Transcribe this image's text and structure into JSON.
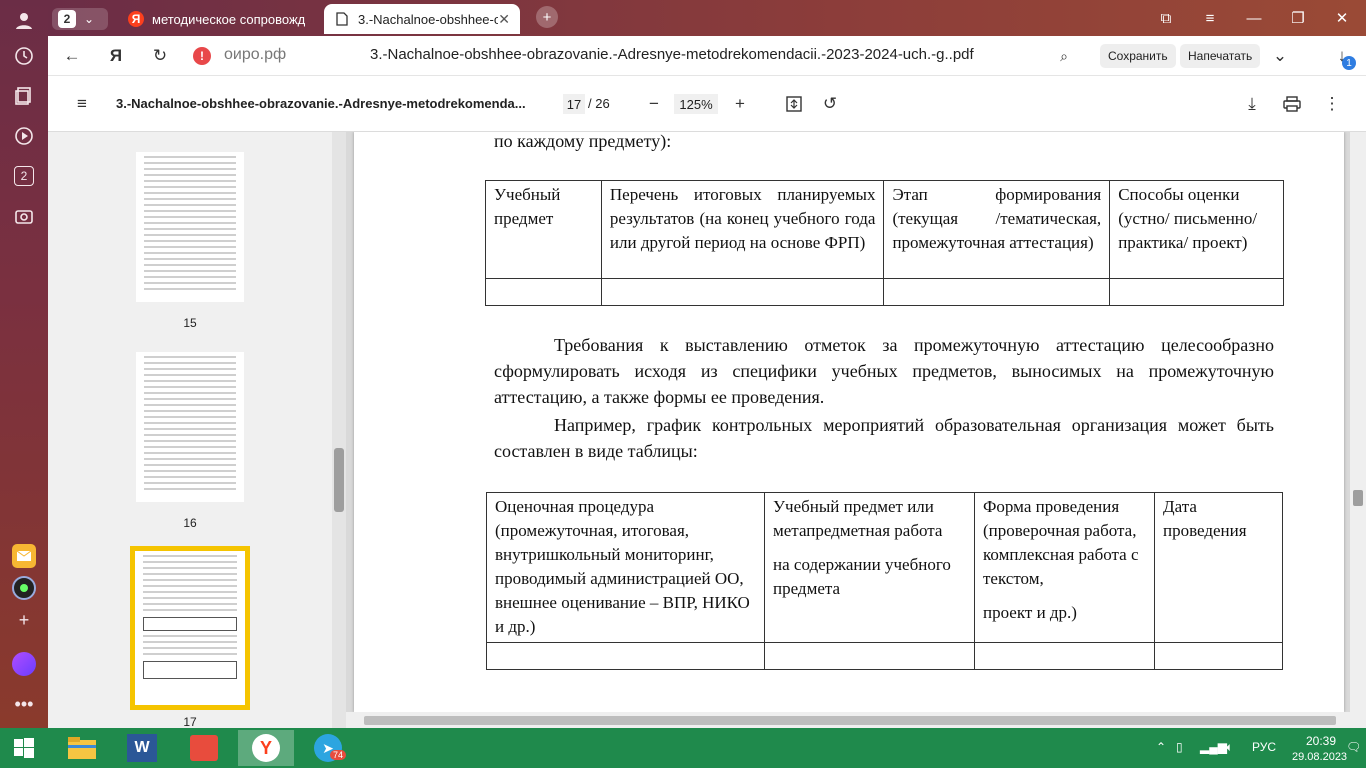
{
  "browser": {
    "tabs": [
      {
        "label": "методическое сопровожд",
        "icon": "Я",
        "active": false
      },
      {
        "label": "3.-Nachalnoe-obshhee-o",
        "icon": "doc-icon",
        "active": true
      }
    ],
    "tab_counter": "2",
    "address": {
      "domain": "оиро.рф",
      "page_title": "3.-Nachalnoe-obshhee-obrazovanie.-Adresnye-metodrekomendacii.-2023-2024-uch.-g..pdf",
      "save_label": "Сохранить",
      "print_label": "Напечатать",
      "downloads_badge": "1"
    },
    "sidebar_badge": "2"
  },
  "pdf_toolbar": {
    "title": "3.-Nachalnoe-obshhee-obrazovanie.-Adresnye-metodrekomenda...",
    "current_page": "17",
    "total_pages": "/ 26",
    "zoom": "125%"
  },
  "thumbnails": [
    {
      "num": "15"
    },
    {
      "num": "16"
    },
    {
      "num": "17",
      "selected": true
    }
  ],
  "document": {
    "intro_line": "по каждому предмету):",
    "table1": {
      "headers": [
        "Учебный предмет",
        "Перечень итоговых планируемых результатов (на конец учебного года или другой период на основе ФРП)",
        "Этап формирования (текущая /тематическая, промежуточная аттестация)",
        "Способы оценки (устно/ письменно/ практика/ проект)"
      ]
    },
    "para1": "Требования к выставлению отметок за промежуточную аттестацию целесообразно сформулировать исходя из специфики учебных предметов, выносимых на промежуточную аттестацию, а также формы ее проведения.",
    "para2": "Например, график контрольных мероприятий образовательная организация может быть составлен в виде таблицы:",
    "table2": {
      "col1": "Оценочная процедура (промежуточная, итоговая, внутришкольный мониторинг, проводимый администрацией ОО, внешнее оценивание – ВПР, НИКО и др.)",
      "col2a": "Учебный предмет или метапредметная работа",
      "col2b": "на содержании учебного предмета",
      "col3a": "Форма проведения (проверочная работа, комплексная работа с текстом,",
      "col3b": "проект и др.)",
      "col4": "Дата проведения"
    }
  },
  "taskbar": {
    "telegram_badge": "74",
    "lang": "РУС",
    "time": "20:39",
    "date": "29.08.2023"
  },
  "colors": {
    "taskbar": "#1f8a4c",
    "thumb_selected": "#f5c400",
    "warning": "#e8484a"
  }
}
